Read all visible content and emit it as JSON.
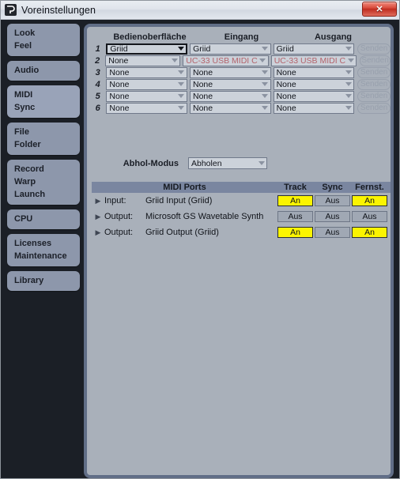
{
  "window": {
    "title": "Voreinstellungen",
    "app_icon": "ableton-icon",
    "close_label": "✕"
  },
  "sidebar": {
    "groups": [
      {
        "id": "look-feel",
        "selected": false,
        "lines": [
          "Look",
          "Feel"
        ]
      },
      {
        "id": "audio",
        "selected": false,
        "lines": [
          "Audio"
        ]
      },
      {
        "id": "midi-sync",
        "selected": true,
        "lines": [
          "MIDI",
          "Sync"
        ]
      },
      {
        "id": "file-folder",
        "selected": false,
        "lines": [
          "File",
          "Folder"
        ]
      },
      {
        "id": "record-warp-launch",
        "selected": false,
        "lines": [
          "Record",
          "Warp",
          "Launch"
        ]
      },
      {
        "id": "cpu",
        "selected": false,
        "lines": [
          "CPU"
        ]
      },
      {
        "id": "licenses-maintenance",
        "selected": false,
        "lines": [
          "Licenses",
          "Maintenance"
        ]
      },
      {
        "id": "library",
        "selected": false,
        "lines": [
          "Library"
        ]
      }
    ]
  },
  "control_surfaces": {
    "columns": [
      "Bedienoberfläche",
      "Eingang",
      "Ausgang"
    ],
    "send_label": "Senden",
    "rows": [
      {
        "num": "1",
        "surface": "Griid",
        "input": "Griid",
        "output": "Griid",
        "focused": true,
        "surface_missing": false,
        "input_missing": false,
        "output_missing": false
      },
      {
        "num": "2",
        "surface": "None",
        "input": "UC-33 USB MIDI C",
        "output": "UC-33 USB MIDI C",
        "focused": false,
        "surface_missing": false,
        "input_missing": true,
        "output_missing": true
      },
      {
        "num": "3",
        "surface": "None",
        "input": "None",
        "output": "None",
        "focused": false,
        "surface_missing": false,
        "input_missing": false,
        "output_missing": false
      },
      {
        "num": "4",
        "surface": "None",
        "input": "None",
        "output": "None",
        "focused": false,
        "surface_missing": false,
        "input_missing": false,
        "output_missing": false
      },
      {
        "num": "5",
        "surface": "None",
        "input": "None",
        "output": "None",
        "focused": false,
        "surface_missing": false,
        "input_missing": false,
        "output_missing": false
      },
      {
        "num": "6",
        "surface": "None",
        "input": "None",
        "output": "None",
        "focused": false,
        "surface_missing": false,
        "input_missing": false,
        "output_missing": false
      }
    ]
  },
  "takeover": {
    "label": "Abhol-Modus",
    "value": "Abholen"
  },
  "midi_ports": {
    "header": {
      "name": "MIDI Ports",
      "track": "Track",
      "sync": "Sync",
      "remote": "Fernst."
    },
    "rows": [
      {
        "direction": "Input:",
        "device": "Griid Input (Griid)",
        "track": "An",
        "track_on": true,
        "sync": "Aus",
        "sync_on": false,
        "remote": "An",
        "remote_on": true
      },
      {
        "direction": "Output:",
        "device": "Microsoft GS Wavetable Synth",
        "track": "Aus",
        "track_on": false,
        "sync": "Aus",
        "sync_on": false,
        "remote": "Aus",
        "remote_on": false
      },
      {
        "direction": "Output:",
        "device": "Griid Output (Griid)",
        "track": "An",
        "track_on": true,
        "sync": "Aus",
        "sync_on": false,
        "remote": "An",
        "remote_on": true
      }
    ]
  },
  "colors": {
    "panel_bg": "#a9b0ba",
    "panel_border": "#616e87",
    "window_bg": "#1b1f26",
    "sidebar_item": "#8d97ab",
    "sidebar_selected": "#99a3b8",
    "toggle_on": "#fbf400",
    "missing_device_text": "#b4636b",
    "ports_header": "#7a86a0"
  }
}
